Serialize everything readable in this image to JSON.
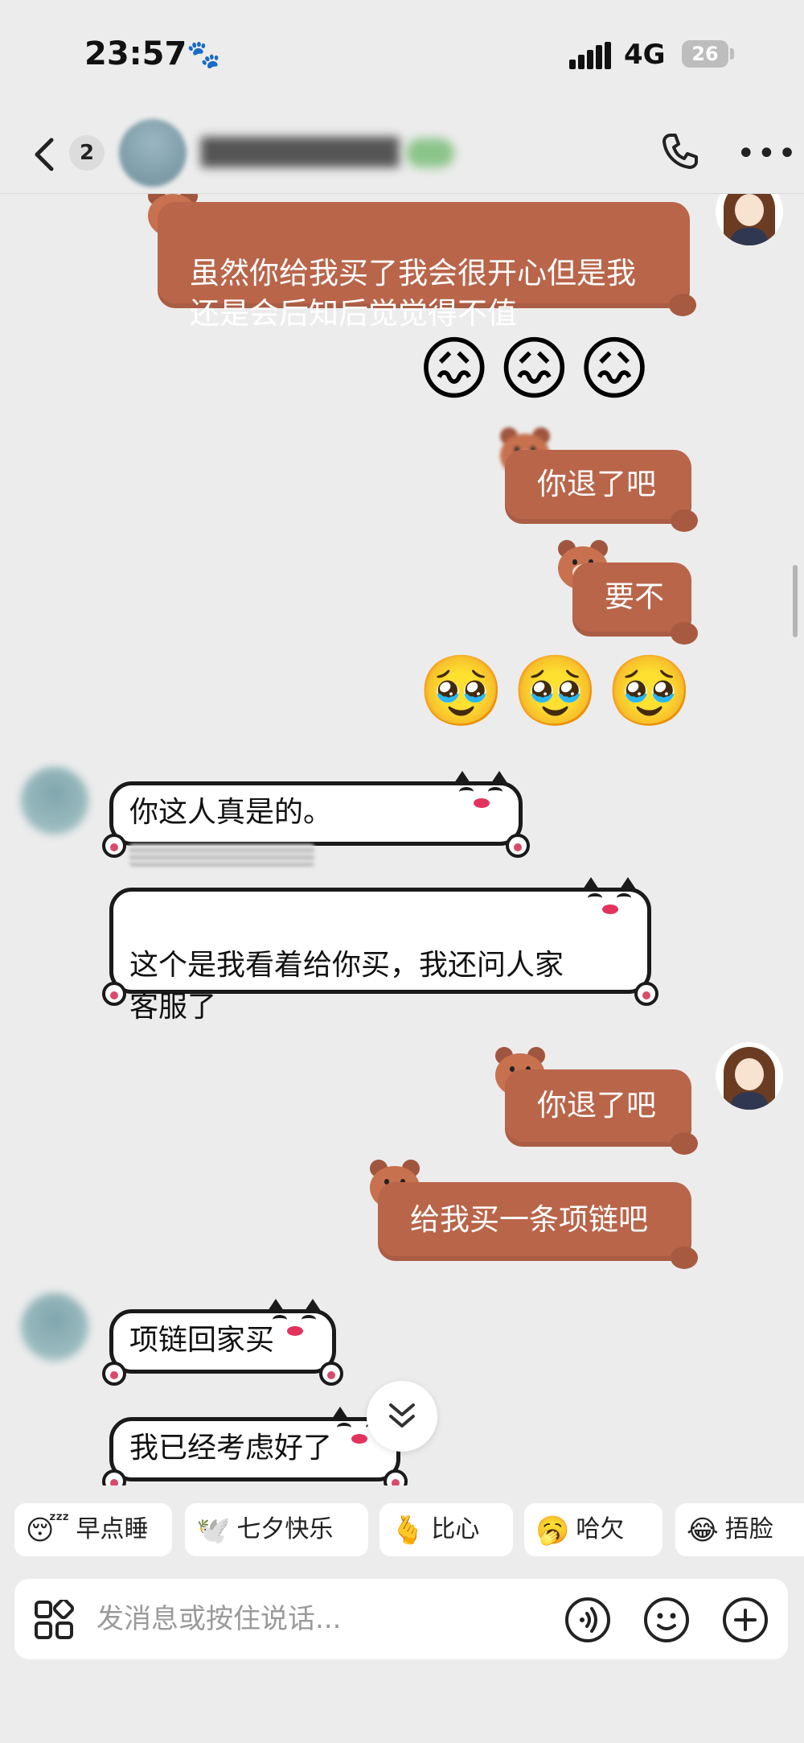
{
  "status": {
    "time": "23:57",
    "network": "4G",
    "battery": "26"
  },
  "header": {
    "unread_count": "2"
  },
  "messages": {
    "m1": "虽然你给我买了我会很开心但是我\n还是会后知后觉觉得不值",
    "m2_emoji": "😖😖😖",
    "m3": "你退了吧",
    "m4": "要不",
    "m5_emoji": "🥹🥹🥹",
    "m6": "你这人真是的。",
    "m7": "这个是我看着给你买，我还问人家\n客服了",
    "m8": "你退了吧",
    "m9": "给我买一条项链吧",
    "m10": "项链回家买",
    "m11": "我已经考虑好了"
  },
  "chips": [
    {
      "emoji": "😴",
      "label": "早点睡"
    },
    {
      "emoji": "🕊️",
      "label": "七夕快乐"
    },
    {
      "emoji": "🫰",
      "label": "比心"
    },
    {
      "emoji": "🥱",
      "label": "哈欠"
    },
    {
      "emoji": "😂",
      "label": "捂脸"
    }
  ],
  "input": {
    "placeholder": "发消息或按住说话..."
  }
}
